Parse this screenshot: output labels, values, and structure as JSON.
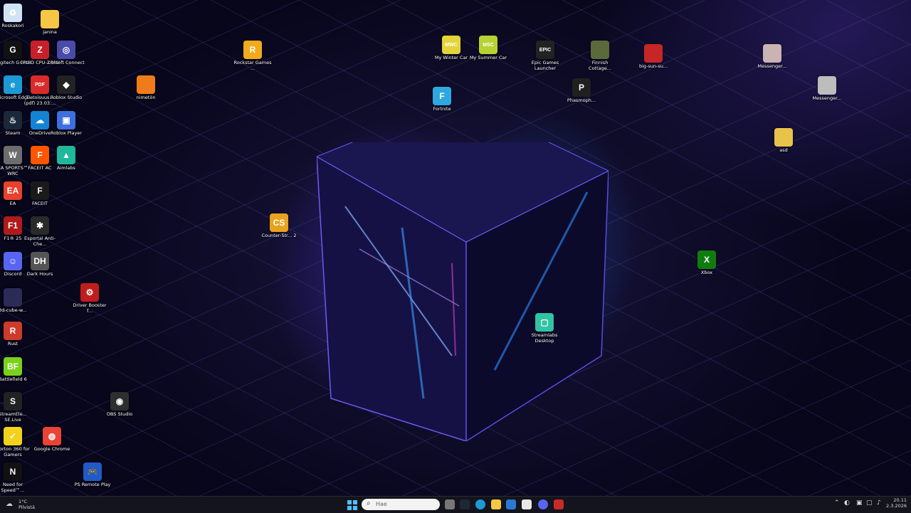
{
  "desktop_icons": [
    {
      "label": "Roskakori",
      "icon": "recycle-bin-icon",
      "color": "#cfe3f5",
      "glyph": "♻"
    },
    {
      "label": "janina",
      "icon": "folder-icon",
      "color": "#f6c744",
      "glyph": ""
    },
    {
      "label": "Logitech G HUB",
      "icon": "logitech-g-icon",
      "color": "#111111",
      "glyph": "G"
    },
    {
      "label": "CPUID CPU-Z MSI",
      "icon": "cpuz-icon",
      "color": "#c8202a",
      "glyph": "Z"
    },
    {
      "label": "Ubisoft Connect",
      "icon": "ubisoft-icon",
      "color": "#4a4aa8",
      "glyph": "◎"
    },
    {
      "label": "Microsoft Edge",
      "icon": "edge-icon",
      "color": "#1c9ad6",
      "glyph": "e"
    },
    {
      "label": "Tietoisuus... (pdf) 23.03....",
      "icon": "pdf-icon",
      "color": "#d92b2b",
      "glyph": "PDF"
    },
    {
      "label": "Roblox Studio",
      "icon": "roblox-studio-icon",
      "color": "#222222",
      "glyph": "◆"
    },
    {
      "label": "nimetön",
      "icon": "file-icon",
      "color": "#f07b1b",
      "glyph": ""
    },
    {
      "label": "Steam",
      "icon": "steam-icon",
      "color": "#1b2838",
      "glyph": "♨"
    },
    {
      "label": "OneDrive",
      "icon": "onedrive-icon",
      "color": "#1483d4",
      "glyph": "☁"
    },
    {
      "label": "Roblox Player",
      "icon": "roblox-player-icon",
      "color": "#3e6fe0",
      "glyph": "▣"
    },
    {
      "label": "EA SPORTS™ WRC",
      "icon": "wrc-icon",
      "color": "#6d6d6d",
      "glyph": "W"
    },
    {
      "label": "FACEIT AC",
      "icon": "faceit-ac-icon",
      "color": "#ff5500",
      "glyph": "F"
    },
    {
      "label": "Aimlabs",
      "icon": "aimlabs-icon",
      "color": "#1fb89a",
      "glyph": "▲"
    },
    {
      "label": "EA",
      "icon": "ea-icon",
      "color": "#e8412c",
      "glyph": "EA"
    },
    {
      "label": "FACEIT",
      "icon": "faceit-icon",
      "color": "#1a1a1a",
      "glyph": "F"
    },
    {
      "label": "F1® 25",
      "icon": "f1-icon",
      "color": "#b01a1a",
      "glyph": "F1"
    },
    {
      "label": "Esportal Anti-Che...",
      "icon": "esportal-icon",
      "color": "#2a2a2a",
      "glyph": "✱"
    },
    {
      "label": "Discord",
      "icon": "discord-icon",
      "color": "#5865f2",
      "glyph": "☺"
    },
    {
      "label": "Dark Hours",
      "icon": "dark-hours-icon",
      "color": "#555555",
      "glyph": "DH"
    },
    {
      "label": "Driver Booster f...",
      "icon": "driver-booster-icon",
      "color": "#c01d1d",
      "glyph": "⚙"
    },
    {
      "label": "3d-cube-w...",
      "icon": "image-file-icon",
      "color": "#2b2b55",
      "glyph": ""
    },
    {
      "label": "Rust",
      "icon": "rust-icon",
      "color": "#cd3b2a",
      "glyph": "R"
    },
    {
      "label": "Battlefield 6",
      "icon": "battlefield-icon",
      "color": "#7ad11c",
      "glyph": "BF"
    },
    {
      "label": "StreamEle... SE.Live",
      "icon": "streamelements-icon",
      "color": "#222222",
      "glyph": "S"
    },
    {
      "label": "OBS Studio",
      "icon": "obs-icon",
      "color": "#2e2e2e",
      "glyph": "◉"
    },
    {
      "label": "Norton 360 for Gamers",
      "icon": "norton-icon",
      "color": "#f2d21c",
      "glyph": "✓"
    },
    {
      "label": "Google Chrome",
      "icon": "chrome-icon",
      "color": "#e84335",
      "glyph": "◍"
    },
    {
      "label": "Need for Speed™...",
      "icon": "nfs-icon",
      "color": "#111111",
      "glyph": "N"
    },
    {
      "label": "PS Remote Play",
      "icon": "ps-remote-play-icon",
      "color": "#1f5ac8",
      "glyph": "🎮"
    },
    {
      "label": "Rockstar Games ...",
      "icon": "rockstar-icon",
      "color": "#f2ab1c",
      "glyph": "R"
    },
    {
      "label": "Counter-Str... 2",
      "icon": "counter-strike-icon",
      "color": "#e9a21e",
      "glyph": "CS"
    },
    {
      "label": "Fortnite",
      "icon": "fortnite-icon",
      "color": "#2fa8e0",
      "glyph": "F"
    },
    {
      "label": "My Winter Car",
      "icon": "my-winter-car-icon",
      "color": "#e3d43a",
      "glyph": "MWC"
    },
    {
      "label": "My Summer Car",
      "icon": "my-summer-car-icon",
      "color": "#b6d233",
      "glyph": "MSC"
    },
    {
      "label": "Epic Games Launcher",
      "icon": "epic-games-icon",
      "color": "#222222",
      "glyph": "EPIC"
    },
    {
      "label": "Finnish Cottage...",
      "icon": "finnish-cottage-icon",
      "color": "#5a6a3a",
      "glyph": ""
    },
    {
      "label": "Phasmoph...",
      "icon": "phasmophobia-icon",
      "color": "#202020",
      "glyph": "P"
    },
    {
      "label": "big-sun-su...",
      "icon": "image-file-icon",
      "color": "#c72626",
      "glyph": ""
    },
    {
      "label": "Messenger...",
      "icon": "messenger-icon",
      "color": "#c9b3b3",
      "glyph": ""
    },
    {
      "label": "Messenger...",
      "icon": "messenger-icon",
      "color": "#bdbdbd",
      "glyph": ""
    },
    {
      "label": "asd",
      "icon": "folder-icon",
      "color": "#e8c34a",
      "glyph": ""
    },
    {
      "label": "Xbox",
      "icon": "xbox-icon",
      "color": "#107c10",
      "glyph": "X"
    },
    {
      "label": "Streamlabs Desktop",
      "icon": "streamlabs-icon",
      "color": "#31c3a2",
      "glyph": "▢"
    }
  ],
  "taskbar": {
    "weather_temp": "1°C",
    "weather_desc": "Pilvistä",
    "search_placeholder": "Hae",
    "clock_time": "20.11",
    "clock_date": "2.3.2026"
  }
}
